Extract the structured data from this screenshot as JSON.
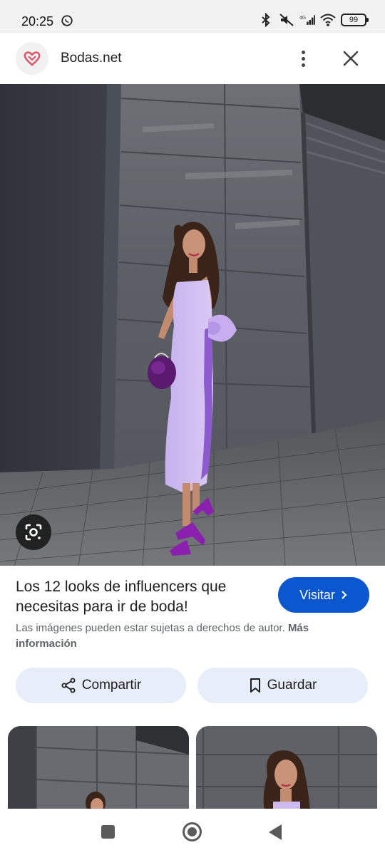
{
  "status_bar": {
    "time": "20:25",
    "battery": "99",
    "network": "4G",
    "icons": [
      "whatsapp-icon",
      "bluetooth-icon",
      "mute-icon",
      "signal-icon",
      "wifi-icon",
      "battery-icon"
    ]
  },
  "header": {
    "site_name": "Bodas.net",
    "logo_icon": "heart-logo-icon",
    "accent_color": "#e2566c"
  },
  "image": {
    "lens_icon": "google-lens-icon"
  },
  "info": {
    "title": "Los 12 looks de influencers que necesitas para ir de boda!",
    "visit_label": "Visitar",
    "copyright_text": "Las imágenes pueden estar sujetas a derechos de autor.",
    "more_info_label": "Más información"
  },
  "actions": {
    "share_label": "Compartir",
    "save_label": "Guardar"
  },
  "colors": {
    "visit_button": "#0b57d0",
    "action_button_bg": "#e8eef9",
    "dress_lilac": "#c9b3ee",
    "shoes_purple": "#8a1fb0"
  }
}
